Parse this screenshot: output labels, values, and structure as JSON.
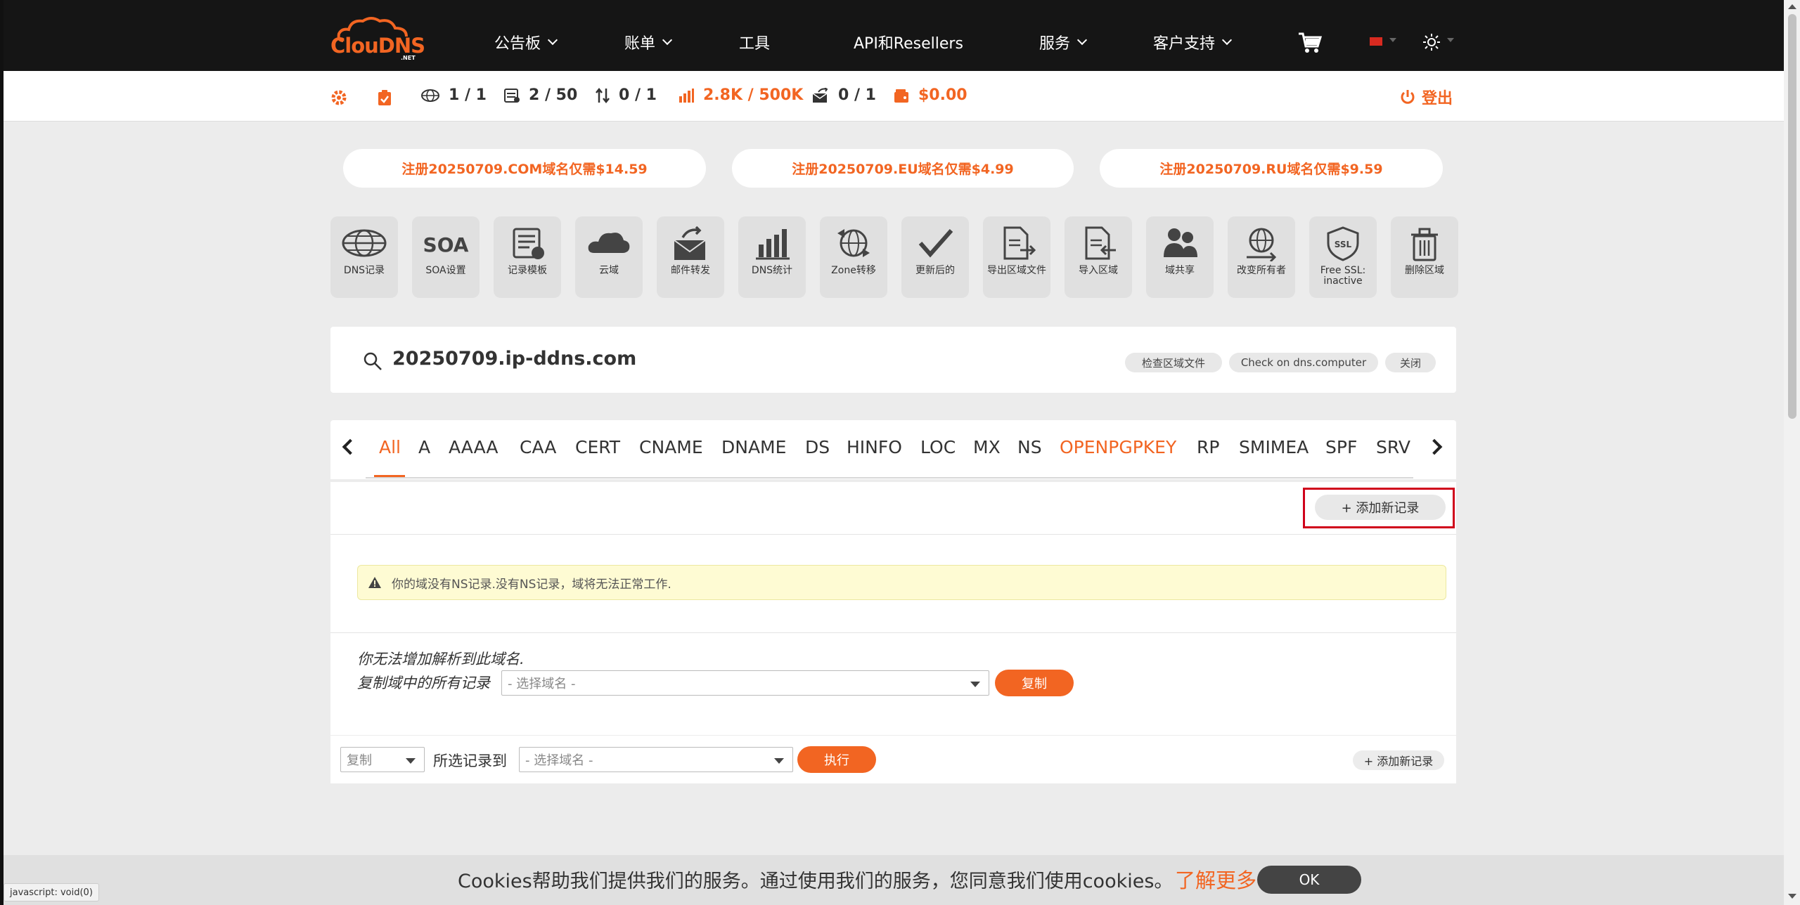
{
  "nav": {
    "logo_text": "ClouDNS",
    "logo_sub": ".NET",
    "items": [
      {
        "label": "公告板",
        "has_dropdown": true
      },
      {
        "label": "账单",
        "has_dropdown": true
      },
      {
        "label": "工具",
        "has_dropdown": false
      },
      {
        "label": "API和Resellers",
        "has_dropdown": false
      },
      {
        "label": "服务",
        "has_dropdown": true
      },
      {
        "label": "客户支持",
        "has_dropdown": true
      }
    ],
    "icons": [
      "cart-icon",
      "flag-cn-icon",
      "sun-icon"
    ]
  },
  "stats": {
    "zones": "1 / 1",
    "records": "2 / 50",
    "transfers": "0 / 1",
    "queries": "2.8K / 500K",
    "mail": "0 / 1",
    "balance": "$0.00",
    "logout": "登出"
  },
  "promos": [
    "注册20250709.COM域名仅需$14.59",
    "注册20250709.EU域名仅需$4.99",
    "注册20250709.RU域名仅需$9.59"
  ],
  "tools": [
    {
      "label": "DNS记录",
      "icon": "globe-icon"
    },
    {
      "label": "SOA设置",
      "icon": "soa-icon"
    },
    {
      "label": "记录模板",
      "icon": "template-icon"
    },
    {
      "label": "云域",
      "icon": "cloud-icon"
    },
    {
      "label": "邮件转发",
      "icon": "mail-forward-icon"
    },
    {
      "label": "DNS统计",
      "icon": "bar-chart-icon"
    },
    {
      "label": "Zone转移",
      "icon": "zone-transfer-icon"
    },
    {
      "label": "更新后的",
      "icon": "check-icon"
    },
    {
      "label": "导出区域文件",
      "icon": "export-icon"
    },
    {
      "label": "导入区域",
      "icon": "import-icon"
    },
    {
      "label": "域共享",
      "icon": "users-icon"
    },
    {
      "label": "改变所有者",
      "icon": "change-owner-icon"
    },
    {
      "label": "Free SSL: inactive",
      "icon": "ssl-shield-icon"
    },
    {
      "label": "删除区域",
      "icon": "trash-icon"
    }
  ],
  "domain": {
    "name": "20250709.ip-ddns.com",
    "actions": [
      "检查区域文件",
      "Check on dns.computer",
      "关闭"
    ]
  },
  "record_tabs": [
    "All",
    "A",
    "AAAA",
    "CAA",
    "CERT",
    "CNAME",
    "DNAME",
    "DS",
    "HINFO",
    "LOC",
    "MX",
    "NS",
    "OPENPGPKEY",
    "RP",
    "SMIMEA",
    "SPF",
    "SRV"
  ],
  "active_tab": "All",
  "panel": {
    "add_record": "+ 添加新记录",
    "warning": "你的域没有NS记录.没有NS记录，域将无法正常工作.",
    "copy_line1": "你无法增加解析到此域名.",
    "copy_line2": "复制域中的所有记录",
    "select_placeholder": "- 选择域名 -",
    "copy_button": "复制"
  },
  "actionbar": {
    "action_select": "复制",
    "label": "所选记录到",
    "select_placeholder": "- 选择域名 -",
    "execute": "执行",
    "add_record": "+ 添加新记录"
  },
  "cookie": {
    "text": "Cookies帮助我们提供我们的服务。通过使用我们的服务，您同意我们使用cookies。",
    "link": "了解更多",
    "ok": "OK"
  },
  "status_url": "javascript: void(0)",
  "colors": {
    "accent": "#f26522",
    "nav_bg": "#151515",
    "warning_bg": "#fefbd3",
    "highlight": "#d0021b"
  }
}
